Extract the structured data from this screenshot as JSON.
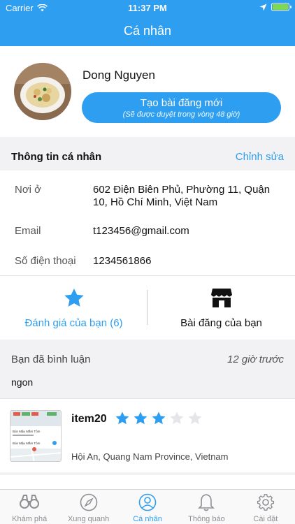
{
  "status_bar": {
    "carrier": "Carrier",
    "time": "11:37 PM"
  },
  "nav": {
    "title": "Cá nhân"
  },
  "profile": {
    "name": "Dong Nguyen",
    "new_post_label": "Tạo bài đăng mới",
    "new_post_sub": "(Sẽ được duyệt trong vòng 48 giờ)"
  },
  "info": {
    "header": "Thông tin cá nhân",
    "edit_label": "Chỉnh sửa",
    "address_label": "Nơi ở",
    "address_value": "602 Điện Biên Phủ, Phường 11, Quận 10, Hồ Chí Minh, Việt Nam",
    "email_label": "Email",
    "email_value": "t123456@gmail.com",
    "phone_label": "Số điện thoại",
    "phone_value": "1234561866"
  },
  "tabs": {
    "reviews_label": "Đánh giá của bạn (6)",
    "posts_label": "Bài đăng của bạn"
  },
  "comment": {
    "who": "Bạn đã bình luận",
    "when": "12 giờ trước",
    "text": "ngon"
  },
  "item": {
    "name": "item20",
    "rating": 3,
    "max_rating": 5,
    "location": "Hội An, Quang Nam Province, Vietnam",
    "thumb_line1": "Bún Mậu Mắm Tôm",
    "thumb_line2": "Bún Mậu Mắm Tôm"
  },
  "tabbar": {
    "explore": "Khám phá",
    "nearby": "Xung quanh",
    "profile": "Cá nhân",
    "notifications": "Thông báo",
    "settings": "Cài đặt"
  },
  "colors": {
    "accent": "#2e9ef0",
    "inactive": "#8e8e93",
    "star_empty": "#e6e6ea"
  }
}
